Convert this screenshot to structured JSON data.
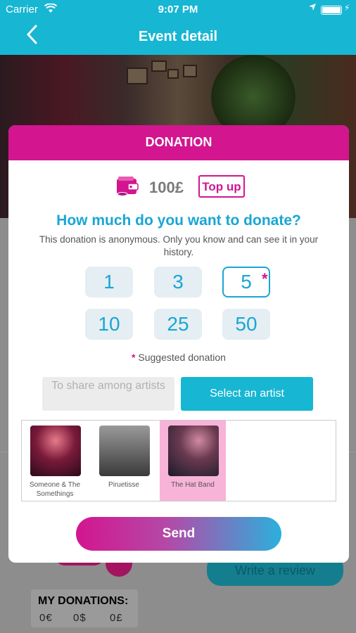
{
  "status_bar": {
    "carrier": "Carrier",
    "time": "9:07 PM"
  },
  "nav": {
    "title": "Event detail",
    "back_icon": "chevron-left-icon"
  },
  "modal": {
    "header": "DONATION",
    "wallet_icon": "wallet-icon",
    "balance": "100£",
    "topup_label": "Top up",
    "question": "How much do you want to donate?",
    "anonymous_note": "This donation is anonymous. Only you know and can see it in your history.",
    "amounts": [
      "1",
      "3",
      "5",
      "10",
      "25",
      "50"
    ],
    "selected_amount": "5",
    "suggested_marker": "*",
    "suggested_label": "Suggested donation",
    "share_option": "To share among artists",
    "select_artist_option": "Select an artist",
    "artists": [
      {
        "name": "Someone & The Somethings",
        "selected": false
      },
      {
        "name": "Piruetisse",
        "selected": false
      },
      {
        "name": "The Hat Band",
        "selected": true
      }
    ],
    "send_label": "Send"
  },
  "background": {
    "review_button": "Write a review",
    "my_donations_label": "MY DONATIONS:",
    "donations": [
      "0€",
      "0$",
      "0£"
    ]
  },
  "colors": {
    "primary": "#17b6d3",
    "accent": "#d3158f",
    "question": "#19a6d4"
  }
}
